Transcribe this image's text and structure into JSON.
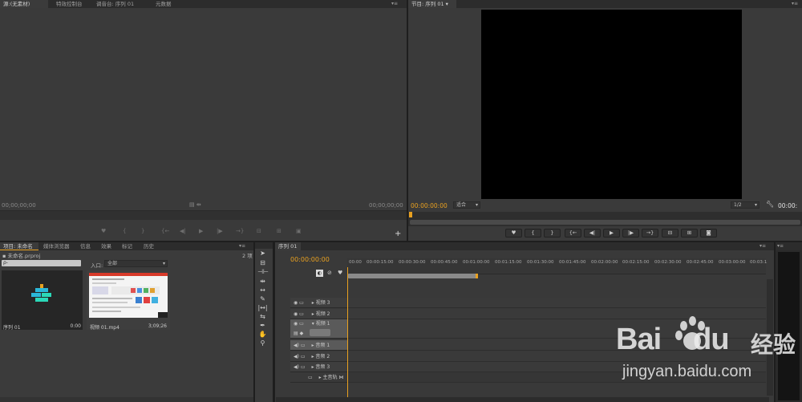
{
  "source_panel": {
    "tabs": [
      "源:(无素材)",
      "特效控制台",
      "调音台: 序列 01",
      "元数据"
    ],
    "timecode_left": "00;00;00;00",
    "timecode_right": "00;00;00;00"
  },
  "program_panel": {
    "tab": "节目: 序列 01",
    "timecode_left": "00:00:00:00",
    "fit_label": "适合",
    "resolution": "1/2",
    "timecode_right": "00:00:"
  },
  "project_panel": {
    "tabs": [
      "项目: 未命名",
      "媒体浏览器",
      "信息",
      "效果",
      "标记",
      "历史"
    ],
    "file_name": "未命名.prproj",
    "item_count": "2 项",
    "search_placeholder": "ρ-",
    "in_label": "入口:",
    "in_value": "全部",
    "items": [
      {
        "name": "序列 01",
        "duration": "0:00"
      },
      {
        "name": "视频 01.mp4",
        "duration": "3;09;26"
      }
    ]
  },
  "timeline": {
    "tab": "序列 01",
    "timecode": "00:00:00:00",
    "ruler": [
      "00:00",
      "00:00:15:00",
      "00:00:30:00",
      "00:00:45:00",
      "00:01:00:00",
      "00:01:15:00",
      "00:01:30:00",
      "00:01:45:00",
      "00:02:00:00",
      "00:02:15:00",
      "00:02:30:00",
      "00:02:45:00",
      "00:03:00:00",
      "00:03:1"
    ],
    "tracks": [
      "视频 3",
      "视频 2",
      "视频 1",
      "音频 1",
      "音频 2",
      "音频 3",
      "主音轨"
    ]
  },
  "watermark": {
    "logo_text": "Bai",
    "logo_text2": "du",
    "logo_cn": "经验",
    "url": "jingyan.baidu.com"
  },
  "colors": {
    "accent": "#e8a020",
    "panel": "#3b3b3b",
    "dark": "#1e1e1e"
  }
}
